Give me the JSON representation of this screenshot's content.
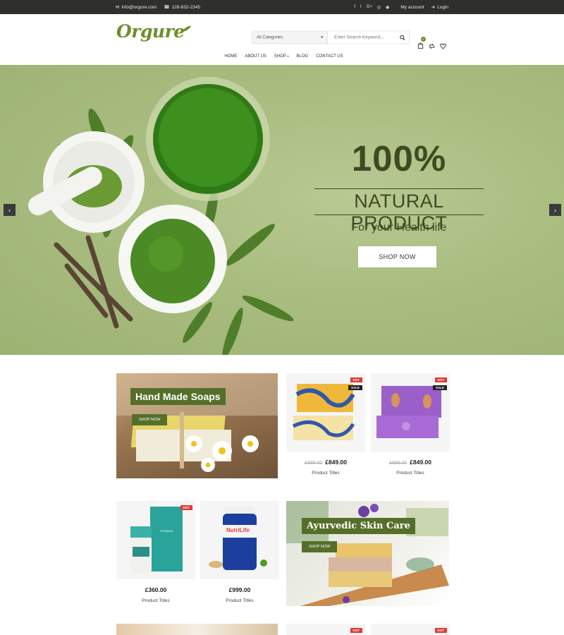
{
  "topbar": {
    "email": "info@orgure.com",
    "phone": "126-632-2345",
    "social": [
      "f",
      "t",
      "G+",
      "◎",
      "◉"
    ],
    "my_account": "My account",
    "login": "Login"
  },
  "header": {
    "logo": "Orgure",
    "category_select": "All Categories",
    "search_placeholder": "Enter Search Keyword...",
    "cart_count": "0"
  },
  "nav": {
    "items": [
      "HOME",
      "ABOUT US",
      "SHOP",
      "BLOG",
      "CONTACT US"
    ]
  },
  "hero": {
    "headline": "100%",
    "subheadline": "NATURAL PRODUCT",
    "tagline": "For your Health life",
    "button": "SHOP NOW"
  },
  "promos": [
    {
      "title": "Hand Made Soaps",
      "button": "SHOP NOW"
    },
    {
      "title": "Ayurvedic Skin Care",
      "button": "SHOP NOW"
    }
  ],
  "products": [
    {
      "old_price": "£899.00",
      "price": "£849.00",
      "title": "Product Titles",
      "tags": [
        "HOT",
        "SALE"
      ]
    },
    {
      "old_price": "£899.00",
      "price": "£849.00",
      "title": "Product Titles",
      "tags": [
        "HOT",
        "SALE"
      ]
    },
    {
      "old_price": "",
      "price": "£360.00",
      "title": "Product Titles",
      "tags": [
        "HOT"
      ]
    },
    {
      "old_price": "",
      "price": "£999.00",
      "title": "Product Titles",
      "tags": []
    }
  ],
  "bottom_tags": [
    "HOT",
    "HOT"
  ],
  "product_labels": {
    "p3_brand": "STEMAVA",
    "p4_brand": "NutriLife"
  },
  "colors": {
    "brand_green": "#6d8f2b",
    "dark_green": "#556f2a",
    "hero_text": "#3e4a22",
    "hot_tag": "#e53935",
    "topbar": "#2f302c"
  }
}
